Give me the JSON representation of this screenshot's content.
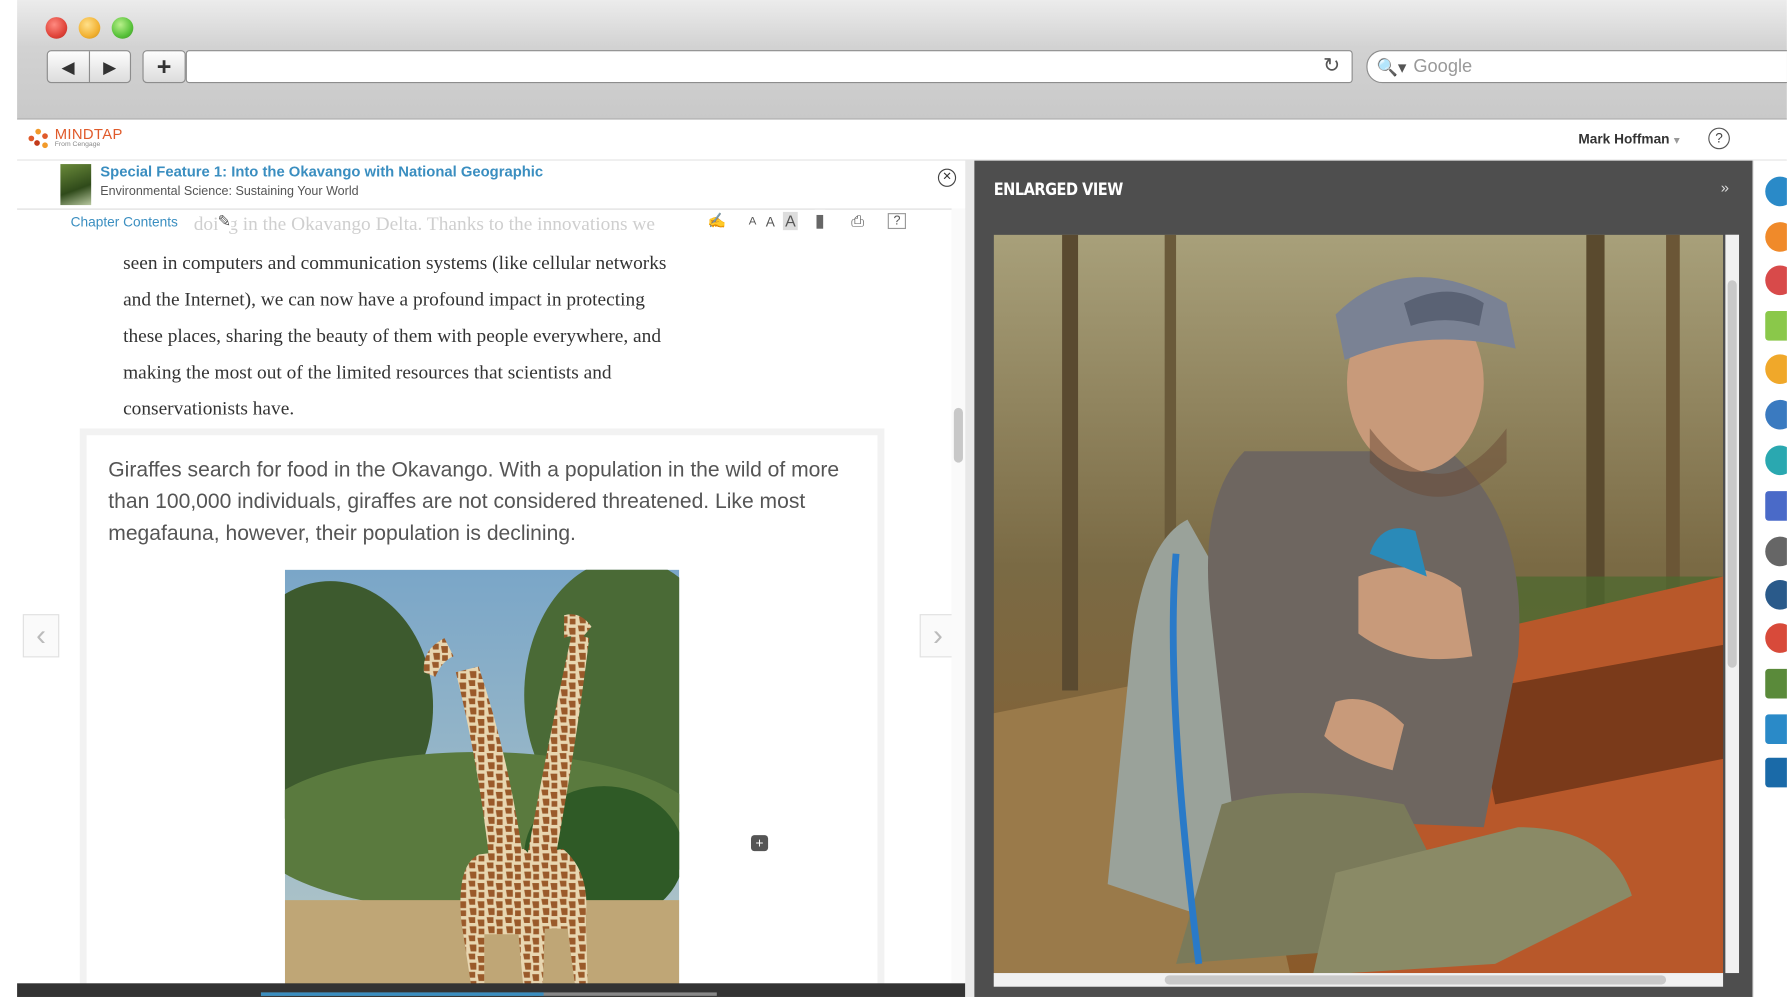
{
  "browser": {
    "back_icon": "◀",
    "forward_icon": "▶",
    "new_tab_icon": "+",
    "url": "",
    "reload_icon": "↻",
    "search_placeholder": "Google"
  },
  "app": {
    "logo_name": "MINDTAP",
    "logo_sub": "From Cengage",
    "user_name": "Mark Hoffman",
    "help_label": "?"
  },
  "reader": {
    "book_title": "Special Feature 1: Into the Okavango with National Geographic",
    "book_subtitle": "Environmental Science: Sustaining Your World",
    "chapter_contents": "Chapter Contents",
    "faded_line": "doing in the Okavango Delta. Thanks to the innovations we",
    "font_sizes": [
      "A",
      "A",
      "A"
    ],
    "body_lines": [
      "seen in computers and communication systems (like cellular networks",
      "and the Internet), we can now have a profound impact in protecting",
      "these places, sharing the beauty of them with people everywhere, and",
      "making the most out of the limited resources that scientists and",
      "conservationists have."
    ],
    "caption": "Giraffes search for food in the Okavango. With a population in the wild of more than 100,000 individuals, giraffes are not considered threatened. Like most megafauna, however, their population is declining.",
    "prev_arrow": "‹",
    "next_arrow": "›",
    "progress_fraction": 0.62
  },
  "enlarged": {
    "title": "ENLARGED VIEW",
    "collapse_icon": "»"
  },
  "colors": {
    "link_blue": "#3a8ec0",
    "brand_orange": "#e05a2a",
    "dark_panel": "#4e4e4e"
  }
}
